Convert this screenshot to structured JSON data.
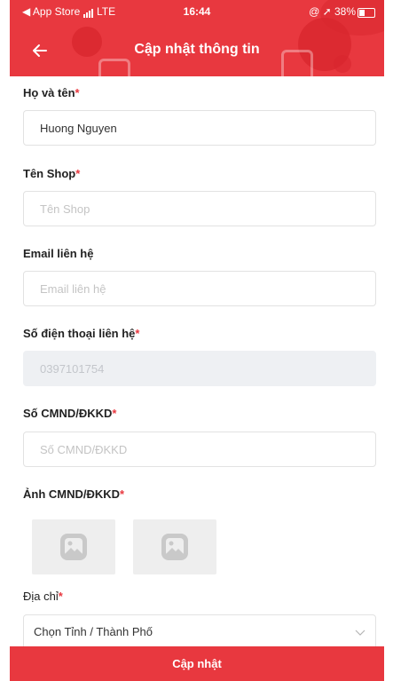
{
  "status_bar": {
    "carrier": "◀ App Store",
    "network": "LTE",
    "time": "16:44",
    "battery_text": "@ ➚ 38%"
  },
  "header": {
    "title": "Cập nhật thông tin",
    "back_icon": "arrow-left-icon"
  },
  "form": {
    "full_name": {
      "label": "Họ và tên",
      "required": "*",
      "value": "Huong Nguyen",
      "placeholder": "Họ và tên"
    },
    "shop_name": {
      "label": "Tên Shop",
      "required": "*",
      "value": "",
      "placeholder": "Tên Shop"
    },
    "email": {
      "label": "Email liên hệ",
      "value": "",
      "placeholder": "Email liên hệ"
    },
    "phone": {
      "label": "Số điện thoại liên hệ",
      "required": "*",
      "value": "0397101754",
      "placeholder": "0397101754"
    },
    "id_number": {
      "label": "Số CMND/ĐKKD",
      "required": "*",
      "value": "",
      "placeholder": "Số CMND/ĐKKD"
    },
    "id_photos": {
      "label": "Ảnh CMND/ĐKKD",
      "required": "*",
      "icon": "image-placeholder-icon"
    },
    "address": {
      "label": "Địa chỉ",
      "required": "*",
      "province_select": "Chọn Tỉnh / Thành Phố"
    }
  },
  "submit_label": "Cập nhật",
  "colors": {
    "accent": "#e8383f",
    "disabled_bg": "#eef0f3"
  }
}
